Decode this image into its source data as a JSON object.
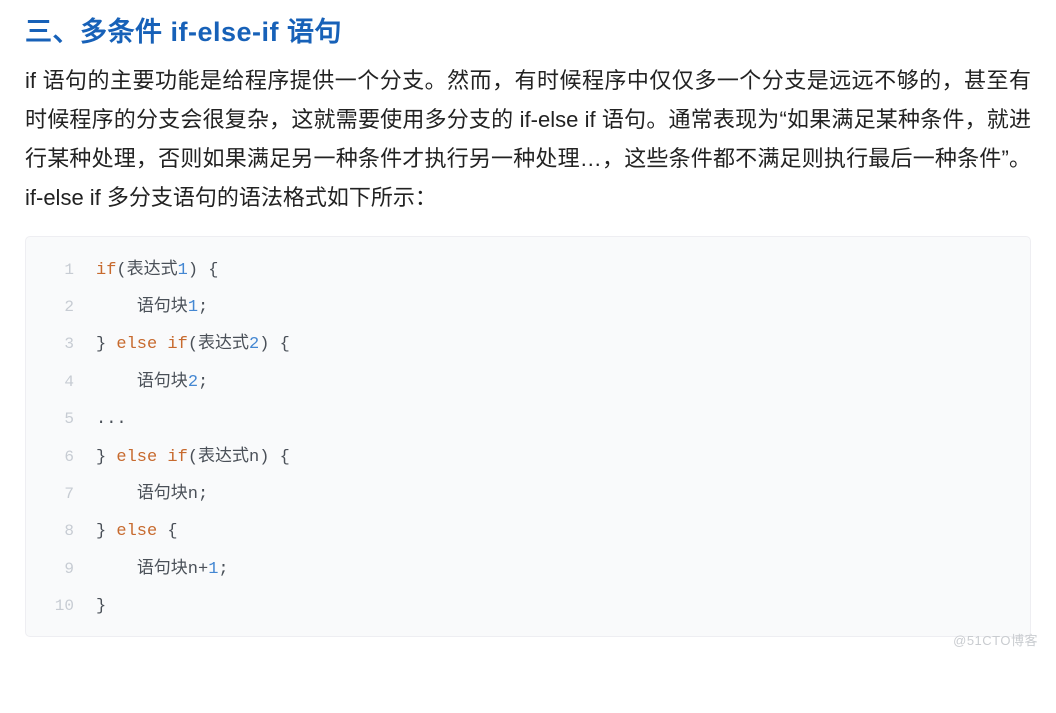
{
  "heading": "三、多条件 if-else-if 语句",
  "paragraph": "if 语句的主要功能是给程序提供一个分支。然而，有时候程序中仅仅多一个分支是远远不够的，甚至有时候程序的分支会很复杂，这就需要使用多分支的 if-else if 语句。通常表现为“如果满足某种条件，就进行某种处理，否则如果满足另一种条件才执行另一种处理…，这些条件都不满足则执行最后一种条件”。if-else if 多分支语句的语法格式如下所示：",
  "code": {
    "lines": [
      {
        "no": "1",
        "tokens": [
          {
            "t": "kw",
            "v": "if"
          },
          {
            "t": "txt",
            "v": "("
          },
          {
            "t": "cjk",
            "v": "表达式"
          },
          {
            "t": "num",
            "v": "1"
          },
          {
            "t": "txt",
            "v": ") {"
          }
        ]
      },
      {
        "no": "2",
        "tokens": [
          {
            "t": "txt",
            "v": "    "
          },
          {
            "t": "cjk",
            "v": "语句块"
          },
          {
            "t": "num",
            "v": "1"
          },
          {
            "t": "txt",
            "v": ";"
          }
        ]
      },
      {
        "no": "3",
        "tokens": [
          {
            "t": "txt",
            "v": "} "
          },
          {
            "t": "kw",
            "v": "else"
          },
          {
            "t": "txt",
            "v": " "
          },
          {
            "t": "kw",
            "v": "if"
          },
          {
            "t": "txt",
            "v": "("
          },
          {
            "t": "cjk",
            "v": "表达式"
          },
          {
            "t": "num",
            "v": "2"
          },
          {
            "t": "txt",
            "v": ") {"
          }
        ]
      },
      {
        "no": "4",
        "tokens": [
          {
            "t": "txt",
            "v": "    "
          },
          {
            "t": "cjk",
            "v": "语句块"
          },
          {
            "t": "num",
            "v": "2"
          },
          {
            "t": "txt",
            "v": ";"
          }
        ]
      },
      {
        "no": "5",
        "tokens": [
          {
            "t": "txt",
            "v": "..."
          }
        ]
      },
      {
        "no": "6",
        "tokens": [
          {
            "t": "txt",
            "v": "} "
          },
          {
            "t": "kw",
            "v": "else"
          },
          {
            "t": "txt",
            "v": " "
          },
          {
            "t": "kw",
            "v": "if"
          },
          {
            "t": "txt",
            "v": "("
          },
          {
            "t": "cjk",
            "v": "表达式n"
          },
          {
            "t": "txt",
            "v": ") {"
          }
        ]
      },
      {
        "no": "7",
        "tokens": [
          {
            "t": "txt",
            "v": "    "
          },
          {
            "t": "cjk",
            "v": "语句块n"
          },
          {
            "t": "txt",
            "v": ";"
          }
        ]
      },
      {
        "no": "8",
        "tokens": [
          {
            "t": "txt",
            "v": "} "
          },
          {
            "t": "kw",
            "v": "else"
          },
          {
            "t": "txt",
            "v": " {"
          }
        ]
      },
      {
        "no": "9",
        "tokens": [
          {
            "t": "txt",
            "v": "    "
          },
          {
            "t": "cjk",
            "v": "语句块n"
          },
          {
            "t": "txt",
            "v": "+"
          },
          {
            "t": "num",
            "v": "1"
          },
          {
            "t": "txt",
            "v": ";"
          }
        ]
      },
      {
        "no": "10",
        "tokens": [
          {
            "t": "txt",
            "v": "}"
          }
        ]
      }
    ]
  },
  "watermark": "@51CTO博客"
}
